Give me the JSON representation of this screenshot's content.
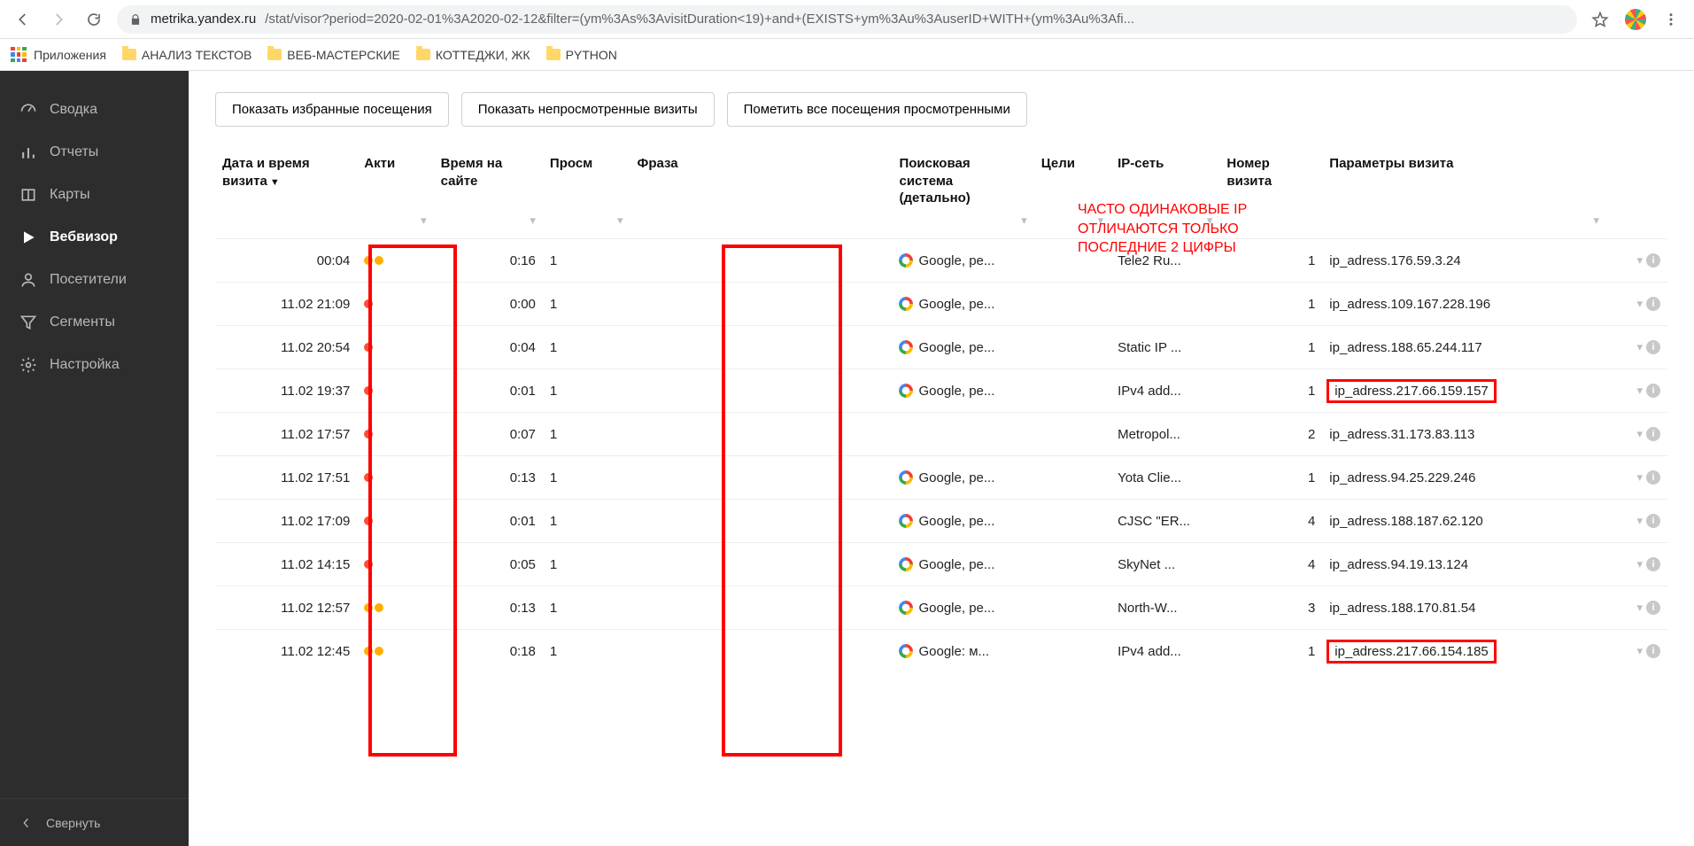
{
  "browser": {
    "url_domain": "metrika.yandex.ru",
    "url_rest": "/stat/visor?period=2020-02-01%3A2020-02-12&filter=(ym%3As%3AvisitDuration<19)+and+(EXISTS+ym%3Au%3AuserID+WITH+(ym%3Au%3Afi...",
    "bookmarks_apps": "Приложения",
    "bookmarks": [
      "АНАЛИЗ ТЕКСТОВ",
      "ВЕБ-МАСТЕРСКИЕ",
      "КОТТЕДЖИ, ЖК",
      "PYTHON"
    ]
  },
  "sidebar": {
    "items": [
      {
        "label": "Сводка"
      },
      {
        "label": "Отчеты"
      },
      {
        "label": "Карты"
      },
      {
        "label": "Вебвизор"
      },
      {
        "label": "Посетители"
      },
      {
        "label": "Сегменты"
      },
      {
        "label": "Настройка"
      }
    ],
    "collapse": "Свернуть"
  },
  "actions": {
    "favorites": "Показать избранные посещения",
    "unseen": "Показать непросмотренные визиты",
    "mark_seen": "Пометить все посещения просмотренными"
  },
  "columns": {
    "date": "Дата и время визита",
    "activity": "Акти",
    "time": "Время на сайте",
    "views": "Просм",
    "phrase": "Фраза",
    "search": "Поисковая система (детально)",
    "goals": "Цели",
    "ipnet": "IP-сеть",
    "number": "Номер визита",
    "params": "Параметры визита"
  },
  "annotation": "ЧАСТО ОДИНАКОВЫЕ IP\nОТЛИЧАЮТСЯ ТОЛЬКО\nПОСЛЕДНИЕ 2 ЦИФРЫ",
  "rows": [
    {
      "date": "00:04",
      "dots": "oo",
      "time": "0:16",
      "views": "1",
      "search": "Google, ре...",
      "has_search": true,
      "ip": "Tele2 Ru...",
      "num": "1",
      "param": "ip_adress.176.59.3.24",
      "hl": false
    },
    {
      "date": "11.02 21:09",
      "dots": "r",
      "time": "0:00",
      "views": "1",
      "search": "Google, ре...",
      "has_search": true,
      "ip": "",
      "num": "1",
      "param": "ip_adress.109.167.228.196",
      "hl": false
    },
    {
      "date": "11.02 20:54",
      "dots": "r",
      "time": "0:04",
      "views": "1",
      "search": "Google, ре...",
      "has_search": true,
      "ip": "Static IP ...",
      "num": "1",
      "param": "ip_adress.188.65.244.117",
      "hl": false
    },
    {
      "date": "11.02 19:37",
      "dots": "r",
      "time": "0:01",
      "views": "1",
      "search": "Google, ре...",
      "has_search": true,
      "ip": "IPv4 add...",
      "num": "1",
      "param": "ip_adress.217.66.159.157",
      "hl": true
    },
    {
      "date": "11.02 17:57",
      "dots": "r",
      "time": "0:07",
      "views": "1",
      "search": "",
      "has_search": false,
      "ip": "Metropol...",
      "num": "2",
      "param": "ip_adress.31.173.83.113",
      "hl": false
    },
    {
      "date": "11.02 17:51",
      "dots": "r",
      "time": "0:13",
      "views": "1",
      "search": "Google, ре...",
      "has_search": true,
      "ip": "Yota Clie...",
      "num": "1",
      "param": "ip_adress.94.25.229.246",
      "hl": false
    },
    {
      "date": "11.02 17:09",
      "dots": "r",
      "time": "0:01",
      "views": "1",
      "search": "Google, ре...",
      "has_search": true,
      "ip": "CJSC \"ER...",
      "num": "4",
      "param": "ip_adress.188.187.62.120",
      "hl": false
    },
    {
      "date": "11.02 14:15",
      "dots": "r",
      "time": "0:05",
      "views": "1",
      "search": "Google, ре...",
      "has_search": true,
      "ip": "SkyNet ...",
      "num": "4",
      "param": "ip_adress.94.19.13.124",
      "hl": false
    },
    {
      "date": "11.02 12:57",
      "dots": "oo",
      "time": "0:13",
      "views": "1",
      "search": "Google, ре...",
      "has_search": true,
      "ip": "North-W...",
      "num": "3",
      "param": "ip_adress.188.170.81.54",
      "hl": false
    },
    {
      "date": "11.02 12:45",
      "dots": "oo",
      "time": "0:18",
      "views": "1",
      "search": "Google: м...",
      "has_search": true,
      "ip": "IPv4 add...",
      "num": "1",
      "param": "ip_adress.217.66.154.185",
      "hl": true
    }
  ]
}
